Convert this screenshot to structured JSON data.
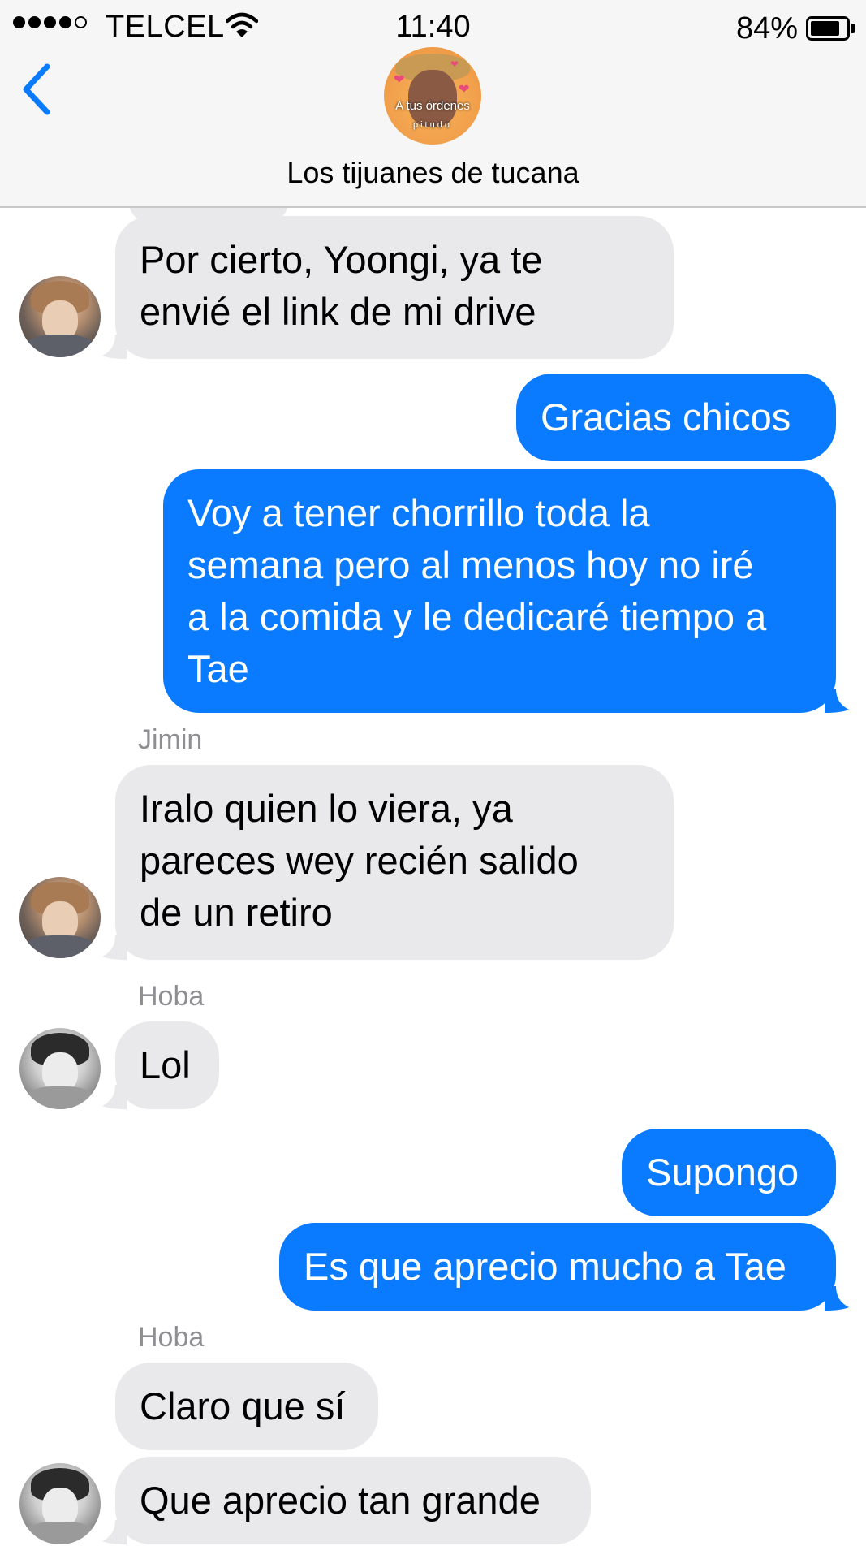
{
  "status_bar": {
    "carrier": "TELCEL",
    "time": "11:40",
    "battery_percent": "84%",
    "battery_level": 0.84,
    "signal_bars_filled": 4,
    "signal_bars_total": 5
  },
  "header": {
    "back_icon": "chevron-left-icon",
    "group_avatar_caption": "A tus órdenes",
    "group_avatar_subcaption": "pitudo",
    "chat_title": "Los tijuanes de tucana"
  },
  "colors": {
    "accent": "#0a7bff",
    "incoming_bubble": "#e9e9eb",
    "outgoing_bubble": "#0a7bff",
    "sender_name": "#8e8e93"
  },
  "messages": [
    {
      "direction": "in",
      "text": "Por cierto, Yoongi, ya te\nenvié el link de mi drive"
    },
    {
      "direction": "out",
      "text": "Gracias chicos"
    },
    {
      "direction": "out",
      "text": "Voy a tener chorrillo toda la\nsemana pero al menos hoy no iré\na la comida y le dedicaré tiempo a\nTae"
    },
    {
      "direction": "in",
      "sender": "Jimin",
      "text": "Iralo quien lo viera, ya\npareces wey recién salido\nde un retiro"
    },
    {
      "direction": "in",
      "sender": "Hoba",
      "text": "Lol"
    },
    {
      "direction": "out",
      "text": "Supongo"
    },
    {
      "direction": "out",
      "text": "Es que aprecio mucho a Tae"
    },
    {
      "direction": "in",
      "sender": "Hoba",
      "text": "Claro que sí"
    },
    {
      "direction": "in",
      "text": "Que aprecio tan grande"
    }
  ]
}
